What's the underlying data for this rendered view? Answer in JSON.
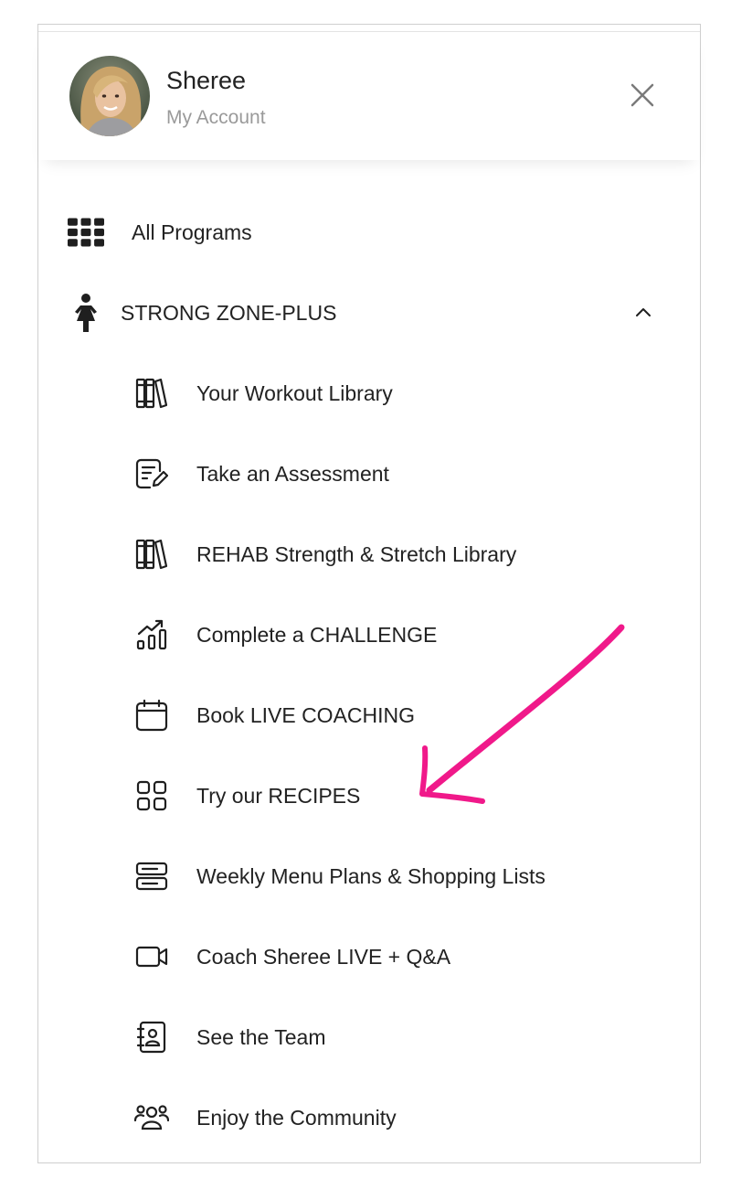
{
  "header": {
    "user_name": "Sheree",
    "account_label": "My Account"
  },
  "menu": {
    "all_programs": {
      "label": "All Programs",
      "icon": "grid-dots-icon"
    },
    "program": {
      "label": "STRONG ZONE-PLUS",
      "icon": "person-icon",
      "expanded": true
    },
    "items": [
      {
        "label": "Your Workout Library",
        "icon": "books-icon"
      },
      {
        "label": "Take an Assessment",
        "icon": "form-edit-icon"
      },
      {
        "label": "REHAB Strength & Stretch Library",
        "icon": "books-icon"
      },
      {
        "label": "Complete a CHALLENGE",
        "icon": "chart-trend-icon"
      },
      {
        "label": "Book LIVE COACHING",
        "icon": "calendar-icon"
      },
      {
        "label": "Try our RECIPES",
        "icon": "apps-grid-icon"
      },
      {
        "label": "Weekly Menu Plans & Shopping Lists",
        "icon": "server-stack-icon"
      },
      {
        "label": "Coach Sheree LIVE + Q&A",
        "icon": "video-camera-icon"
      },
      {
        "label": "See the Team",
        "icon": "contact-book-icon"
      },
      {
        "label": "Enjoy the Community",
        "icon": "users-group-icon"
      }
    ]
  },
  "annotation": {
    "color": "#f0198a"
  }
}
